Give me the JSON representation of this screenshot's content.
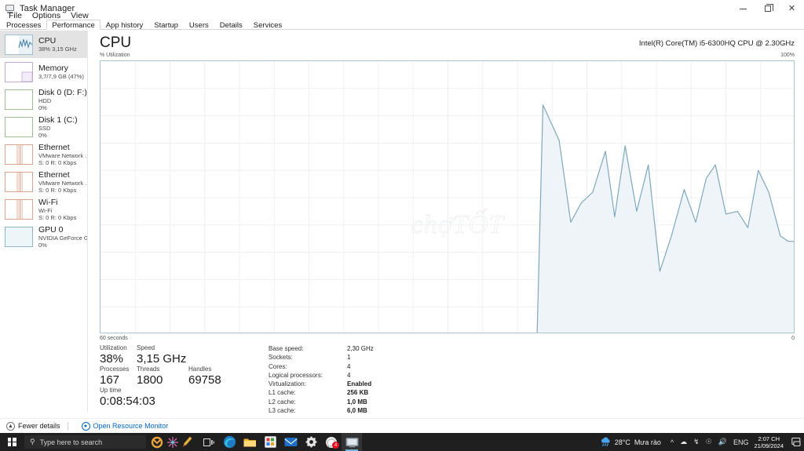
{
  "window": {
    "title": "Task Manager",
    "icon": "task-manager-icon",
    "controls": {
      "minimize": "–",
      "maximize": "❐",
      "close": "✕"
    }
  },
  "menu": {
    "items": [
      "File",
      "Options",
      "View"
    ]
  },
  "tabs": {
    "items": [
      "Processes",
      "Performance",
      "App history",
      "Startup",
      "Users",
      "Details",
      "Services"
    ],
    "active": "Performance"
  },
  "sidebar": {
    "items": [
      {
        "title": "CPU",
        "sub1": "38% 3,15 GHz",
        "sub2": "",
        "kind": "cpu",
        "selected": true
      },
      {
        "title": "Memory",
        "sub1": "3,7/7,9 GB (47%)",
        "sub2": "",
        "kind": "mem",
        "selected": false
      },
      {
        "title": "Disk 0 (D: F:)",
        "sub1": "HDD",
        "sub2": "0%",
        "kind": "disk",
        "selected": false
      },
      {
        "title": "Disk 1 (C:)",
        "sub1": "SSD",
        "sub2": "0%",
        "kind": "disk",
        "selected": false
      },
      {
        "title": "Ethernet",
        "sub1": "VMware Network ...",
        "sub2": "S: 0 R: 0 Kbps",
        "kind": "net",
        "selected": false
      },
      {
        "title": "Ethernet",
        "sub1": "VMware Network ...",
        "sub2": "S: 0 R: 0 Kbps",
        "kind": "net",
        "selected": false
      },
      {
        "title": "Wi-Fi",
        "sub1": "Wi-Fi",
        "sub2": "S: 0 R: 0 Kbps",
        "kind": "net",
        "selected": false
      },
      {
        "title": "GPU 0",
        "sub1": "NVIDIA GeForce G...",
        "sub2": "0%",
        "kind": "gpu",
        "selected": false
      }
    ]
  },
  "main": {
    "heading": "CPU",
    "model": "Intel(R) Core(TM) i5-6300HQ CPU @ 2.30GHz",
    "axis_top_left": "% Utilization",
    "axis_top_right": "100%",
    "axis_bottom_left": "60 seconds",
    "axis_bottom_right": "0",
    "watermark": "chợTỐT"
  },
  "chart_data": {
    "type": "area",
    "title": "% Utilization",
    "xlabel": "60 seconds",
    "ylabel": "% Utilization",
    "xlim": [
      60,
      0
    ],
    "ylim": [
      0,
      100
    ],
    "grid": true,
    "legend": "none",
    "line_color": "#7fa8bc",
    "fill_color": "#eff4f9",
    "series": [
      {
        "name": "CPU Utilization",
        "seconds_ago": [
          60,
          22.3,
          21.8,
          20.4,
          19.4,
          18.5,
          17.5,
          16.4,
          15.6,
          14.7,
          13.7,
          12.7,
          11.7,
          10.7,
          9.6,
          8.6,
          7.7,
          6.9,
          6.0,
          5.0,
          4.1,
          3.2,
          2.3,
          1.3,
          0.6,
          0.0
        ],
        "values": [
          0,
          0,
          84,
          71,
          41,
          48,
          52,
          67,
          43,
          69,
          45,
          62,
          23,
          36,
          53,
          41,
          57,
          62,
          44,
          45,
          39,
          60,
          52,
          36,
          34,
          34
        ]
      }
    ]
  },
  "stats": {
    "left": [
      {
        "label": "Utilization",
        "value": "38%"
      },
      {
        "label": "Speed",
        "value": "3,15 GHz"
      },
      {
        "label": "Processes",
        "value": "167"
      },
      {
        "label": "Threads",
        "value": "1800"
      },
      {
        "label": "Handles",
        "value": "69758"
      },
      {
        "label": "Up time",
        "value": "0:08:54:03"
      }
    ],
    "right": [
      {
        "label": "Base speed:",
        "value": "2,30 GHz",
        "bold": false
      },
      {
        "label": "Sockets:",
        "value": "1",
        "bold": false
      },
      {
        "label": "Cores:",
        "value": "4",
        "bold": false
      },
      {
        "label": "Logical processors:",
        "value": "4",
        "bold": false
      },
      {
        "label": "Virtualization:",
        "value": "Enabled",
        "bold": true
      },
      {
        "label": "L1 cache:",
        "value": "256 KB",
        "bold": true
      },
      {
        "label": "L2 cache:",
        "value": "1,0 MB",
        "bold": true
      },
      {
        "label": "L3 cache:",
        "value": "6,0 MB",
        "bold": true
      }
    ]
  },
  "statusbar": {
    "fewer_details": "Fewer details",
    "resource_monitor": "Open Resource Monitor"
  },
  "taskbar": {
    "start": "start-button",
    "search_placeholder": "Type here to search",
    "apps": [
      "task-view",
      "edge",
      "file-explorer",
      "microsoft-store",
      "mail",
      "settings",
      "chat",
      "task-manager"
    ],
    "chat_badge": "4",
    "tray": {
      "weather_temp": "28°C",
      "weather_desc": "Mưa rào",
      "language": "ENG",
      "time": "2:07 CH",
      "date": "21/09/2024"
    }
  }
}
